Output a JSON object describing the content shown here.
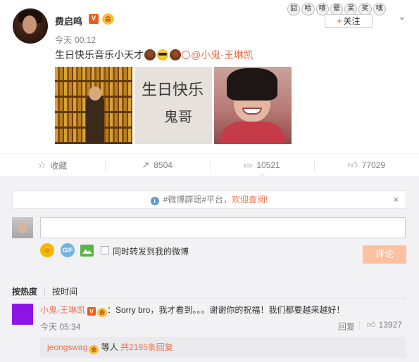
{
  "post": {
    "author": "费启鸣",
    "verified_badge": "V",
    "vip_badge": "会",
    "time_day": "今天",
    "time_clock": "00:12",
    "text_prefix": "生日快乐音乐小天才",
    "mention": "@小鬼-王琳凯",
    "follow_label": "关注",
    "follow_plus": "+",
    "chevron": "⌄",
    "emoji_strip": [
      "囧",
      "哈",
      "嘻",
      "晕",
      "呆",
      "笑",
      "嘿"
    ],
    "photo_caption_line1": "生日快乐",
    "photo_caption_line2": "鬼哥"
  },
  "actions": {
    "favorite_label": "收藏",
    "repost_count": "8504",
    "comment_count": "10521",
    "like_count": "77029"
  },
  "notice": {
    "prefix": "#微博辟谣#平台，",
    "link": "欢迎查阅!",
    "close": "×"
  },
  "composer": {
    "input_value": "",
    "repost_label": "同时转发到我的微博",
    "submit_label": "评论",
    "gif_label": "GIF"
  },
  "sort": {
    "hot_label": "按热度",
    "time_label": "按时间"
  },
  "comment": {
    "name": "小鬼-王琳凯",
    "text": "：Sorry bro，我才看到。。。谢谢你的祝福！我们都要越来越好！",
    "time": "今天 05:34",
    "reply_label": "回复",
    "like_count": "13927",
    "sub_user": "jeongswag",
    "sub_mid": "等人",
    "sub_more": "共2195条回复"
  },
  "colors": {
    "accent": "#eb7350",
    "submit_disabled": "#ffc09f",
    "comment_area_bg": "#f2f2f5",
    "commenter_avatar": "#8f15e6"
  }
}
